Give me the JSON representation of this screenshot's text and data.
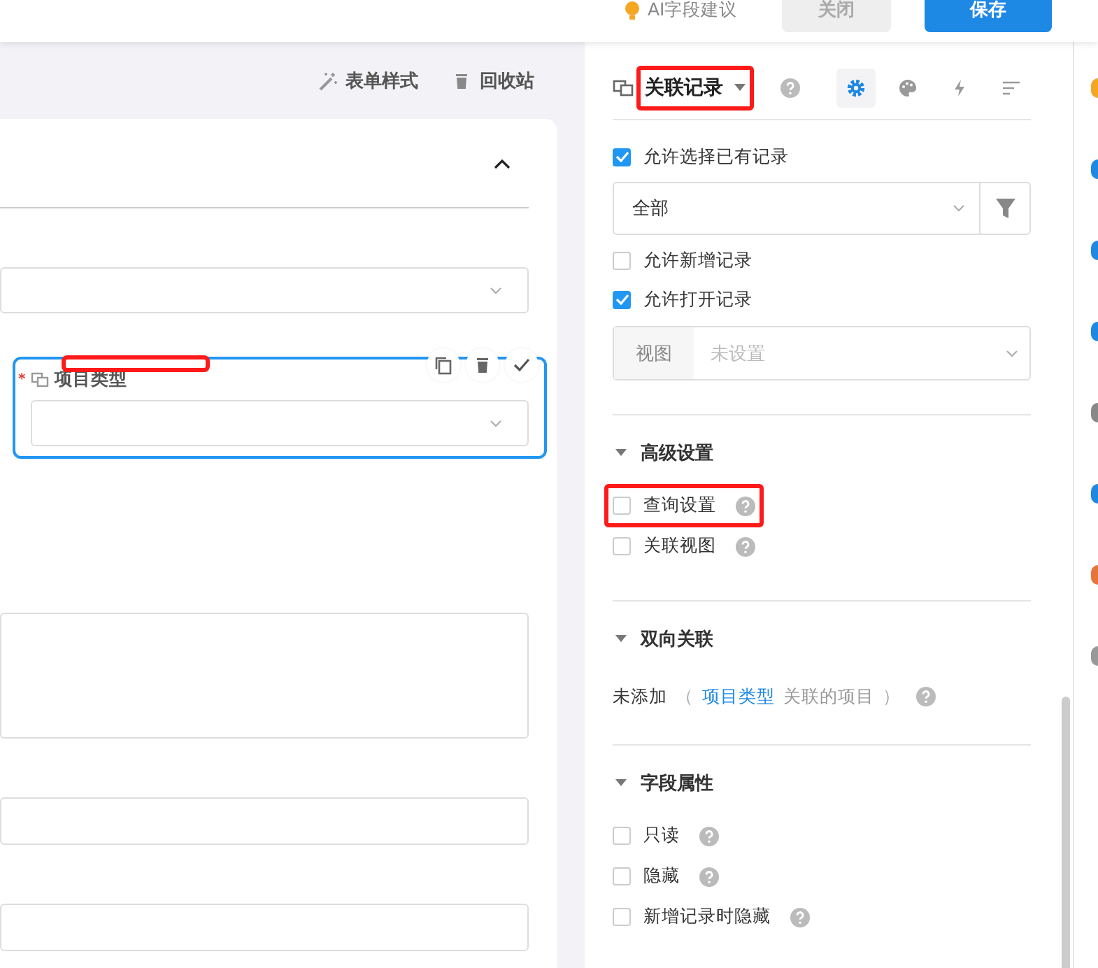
{
  "header": {
    "ai_suggest": "AI字段建议",
    "buttons": [
      {
        "label": "关闭",
        "kind": "secondary"
      },
      {
        "label": "保存",
        "kind": "primary"
      }
    ]
  },
  "toolbar": [
    {
      "label": "表单样式",
      "kind": "wand"
    },
    {
      "label": "回收站",
      "kind": "trash"
    }
  ],
  "form": {
    "expanded": true,
    "fields": [
      {
        "kind": "select",
        "selected": false
      },
      {
        "kind": "select",
        "selected": true,
        "label": "项目类型",
        "required_mark": "*",
        "highlighted": true
      },
      {
        "kind": "textarea",
        "selected": false
      },
      {
        "kind": "input",
        "selected": false
      },
      {
        "kind": "input",
        "selected": false
      }
    ]
  },
  "panel": {
    "field_type": "关联记录",
    "highlighted": true,
    "tabs": [
      {
        "kind": "settings",
        "selected": true
      },
      {
        "kind": "palette",
        "selected": false
      },
      {
        "kind": "bolt",
        "selected": false
      },
      {
        "kind": "sort",
        "selected": false
      }
    ],
    "allow_select": {
      "label": "允许选择已有记录",
      "checked": true
    },
    "scope": {
      "value": "全部"
    },
    "allow_add": {
      "label": "允许新增记录",
      "checked": false
    },
    "allow_open": {
      "label": "允许打开记录",
      "checked": true
    },
    "view": {
      "label": "视图",
      "placeholder": "未设置"
    },
    "sections": [
      {
        "kind": "checks",
        "title": "高级设置",
        "expanded": true,
        "items": [
          {
            "label": "查询设置",
            "checked": false,
            "highlighted": true
          },
          {
            "label": "关联视图",
            "checked": false,
            "highlighted": false
          }
        ]
      },
      {
        "kind": "relation",
        "title": "双向关联",
        "expanded": true,
        "status": "未添加",
        "open": "（",
        "link": "项目类型",
        "suffix": "关联的项目",
        "close": "）"
      },
      {
        "kind": "checks",
        "title": "字段属性",
        "expanded": true,
        "items": [
          {
            "label": "只读",
            "checked": false,
            "highlighted": false
          },
          {
            "label": "隐藏",
            "checked": false,
            "highlighted": false
          },
          {
            "label": "新增记录时隐藏",
            "checked": false,
            "highlighted": false
          }
        ]
      }
    ]
  }
}
